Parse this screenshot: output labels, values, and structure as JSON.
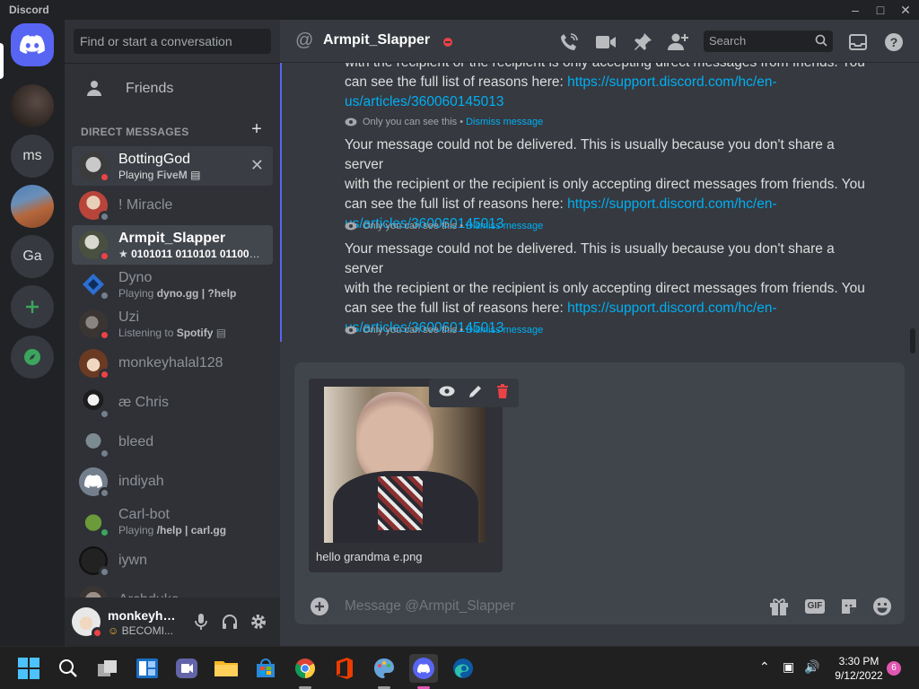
{
  "titlebar": {
    "app_name": "Discord"
  },
  "servers": [
    {
      "label": ""
    },
    {
      "label": "ms"
    },
    {
      "label": ""
    },
    {
      "label": "Ga"
    }
  ],
  "dm_sidebar": {
    "search_placeholder": "Find or start a conversation",
    "friends_label": "Friends",
    "section_title": "DIRECT MESSAGES",
    "items": [
      {
        "name": "BottingGod",
        "activity_prefix": "Playing ",
        "activity": "FiveM",
        "status": "dnd"
      },
      {
        "name": "! Miracle",
        "activity_prefix": "",
        "activity": "",
        "status": "offline"
      },
      {
        "name": "Armpit_Slapper",
        "activity_prefix": "",
        "activity": "0101011 0110101 011000...",
        "status": "dnd"
      },
      {
        "name": "Dyno",
        "activity_prefix": "Playing ",
        "activity": "dyno.gg | ?help",
        "status": "offline"
      },
      {
        "name": "Uzi",
        "activity_prefix": "Listening to ",
        "activity": "Spotify",
        "status": "dnd"
      },
      {
        "name": "monkeyhalal128",
        "activity_prefix": "",
        "activity": "",
        "status": "dnd"
      },
      {
        "name": "æ Chris",
        "activity_prefix": "",
        "activity": "",
        "status": "offline"
      },
      {
        "name": "bleed",
        "activity_prefix": "",
        "activity": "",
        "status": "offline"
      },
      {
        "name": "indiyah",
        "activity_prefix": "",
        "activity": "",
        "status": "offline"
      },
      {
        "name": "Carl-bot",
        "activity_prefix": "Playing ",
        "activity": "/help | carl.gg",
        "status": "online"
      },
      {
        "name": "iywn",
        "activity_prefix": "",
        "activity": "",
        "status": "offline"
      },
      {
        "name": "Archduke",
        "activity_prefix": "",
        "activity": "",
        "status": "offline"
      }
    ]
  },
  "user_panel": {
    "name": "monkeyhal...",
    "status_text": "BECOMI..."
  },
  "channel": {
    "name": "Armpit_Slapper",
    "search_placeholder": "Search"
  },
  "messages": {
    "partial_top_line": "with the recipient or the recipient is only accepting direct messages from friends. You",
    "line_2": "with the recipient or the recipient is only accepting direct messages from friends. You",
    "line_1": "Your message could not be delivered. This is usually because you don't share a server",
    "line_3_prefix": "can see the full list of reasons here: ",
    "link_part1": "https://support.discord.com/hc/en-",
    "link_part2": "us/articles/360060145013",
    "ephemeral_note": "Only you can see this •",
    "dismiss": "Dismiss message"
  },
  "composer": {
    "attachment_filename": "hello grandma e.png",
    "placeholder": "Message @Armpit_Slapper",
    "gif_label": "GIF"
  },
  "taskbar": {
    "time": "3:30 PM",
    "date": "9/12/2022",
    "notification_count": "6"
  }
}
